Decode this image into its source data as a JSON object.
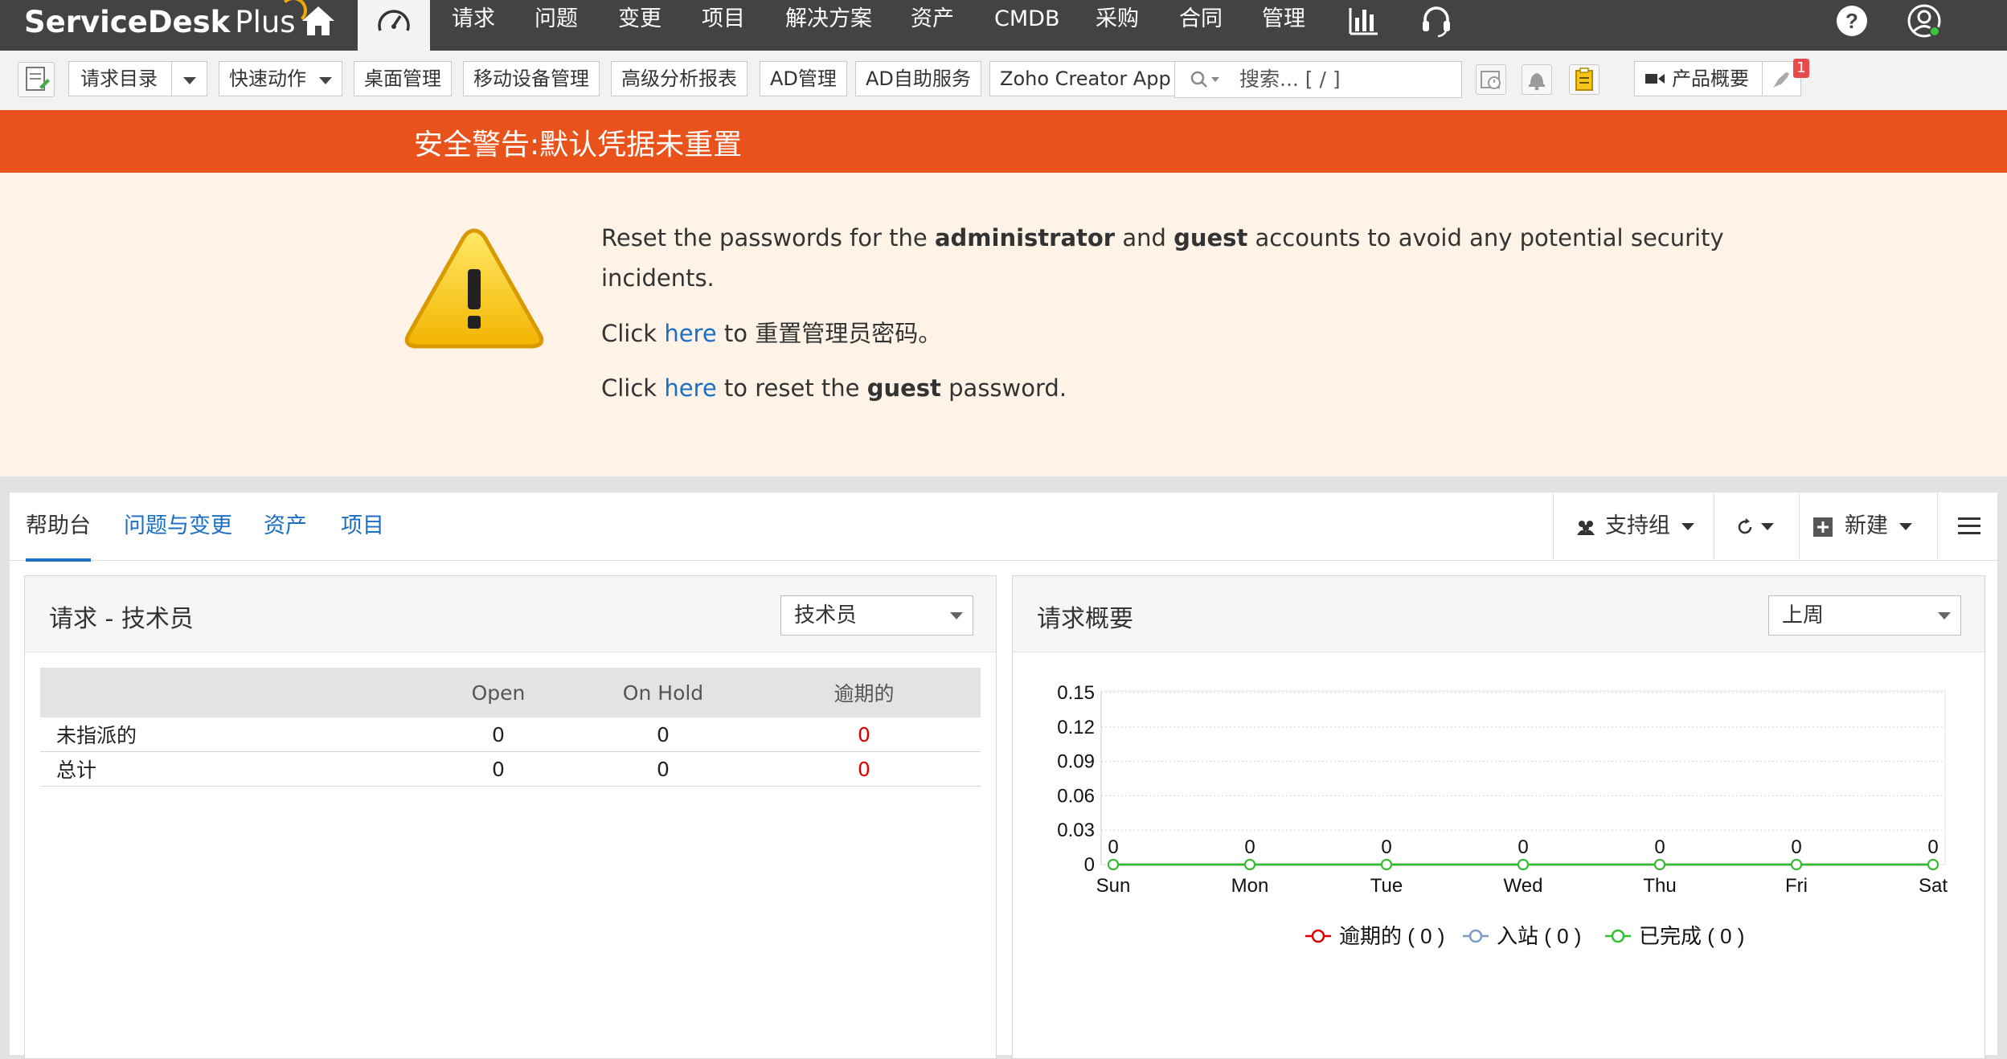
{
  "app": {
    "logo_brand": "ServiceDesk",
    "logo_plus": "Plus"
  },
  "topnav": {
    "items": [
      "请求",
      "问题",
      "变更",
      "项目",
      "解决方案",
      "资产",
      "CMDB",
      "采购",
      "合同",
      "管理"
    ],
    "icons": [
      "home-icon",
      "dashboard-icon",
      "reports-icon",
      "support-headset-icon",
      "help-icon",
      "user-status-icon"
    ]
  },
  "toolbar": {
    "request_catalog": "请求目录",
    "quick_actions": "快速动作",
    "desktop_mgmt": "桌面管理",
    "mobile_mgmt": "移动设备管理",
    "advanced_reports": "高级分析报表",
    "ad_mgmt": "AD管理",
    "ad_selfservice": "AD自助服务",
    "zoho_creator": "Zoho Creator App",
    "search_placeholder": "搜索... [ / ]",
    "product_overview": "产品概要",
    "notification_count": "1"
  },
  "alert": {
    "title": "安全警告:默认凭据未重置",
    "line1_pre": "Reset the passwords for the ",
    "line1_admin": "administrator",
    "line1_and": " and ",
    "line1_guest": "guest",
    "line1_post": " accounts to avoid any potential security",
    "line1_cont": "incidents.",
    "line2_click": "Click ",
    "line2_here": "here",
    "line2_post": " to 重置管理员密码。",
    "line3_click": "Click ",
    "line3_here": "here",
    "line3_mid": " to reset the ",
    "line3_guest": "guest",
    "line3_post": " password."
  },
  "tabs": {
    "helpdesk": "帮助台",
    "problems_changes": "问题与变更",
    "assets": "资产",
    "projects": "项目"
  },
  "right_tools": {
    "support_group": "支持组",
    "new": "新建"
  },
  "widget_requests": {
    "title": "请求 - 技术员",
    "filter": "技术员",
    "columns": [
      "",
      "Open",
      "On Hold",
      "逾期的"
    ],
    "rows": [
      {
        "label": "未指派的",
        "open": "0",
        "on_hold": "0",
        "overdue": "0"
      },
      {
        "label": "总计",
        "open": "0",
        "on_hold": "0",
        "overdue": "0"
      }
    ]
  },
  "widget_summary": {
    "title": "请求概要",
    "filter": "上周",
    "legend": [
      "逾期的 ( 0 )",
      "入站 ( 0 )",
      "已完成 ( 0 )"
    ]
  },
  "colors": {
    "accent": "#1a6ec6",
    "alert": "#e9531b",
    "overdue": "#e10000",
    "inbound": "#7a9cc6",
    "completed": "#2fbf2f"
  },
  "chart_data": {
    "type": "line",
    "categories": [
      "Sun",
      "Mon",
      "Tue",
      "Wed",
      "Thu",
      "Fri",
      "Sat"
    ],
    "ylim": [
      0,
      0.15
    ],
    "yticks": [
      "0",
      "0.03",
      "0.06",
      "0.09",
      "0.12",
      "0.15"
    ],
    "series": [
      {
        "name": "逾期的",
        "values": [
          0,
          0,
          0,
          0,
          0,
          0,
          0
        ],
        "color": "#e10000"
      },
      {
        "name": "入站",
        "values": [
          0,
          0,
          0,
          0,
          0,
          0,
          0
        ],
        "color": "#7a9cc6"
      },
      {
        "name": "已完成",
        "values": [
          0,
          0,
          0,
          0,
          0,
          0,
          0
        ],
        "color": "#2fbf2f"
      }
    ],
    "data_labels": [
      "0",
      "0",
      "0",
      "0",
      "0",
      "0",
      "0"
    ],
    "grid": true,
    "legend": "bottom"
  }
}
